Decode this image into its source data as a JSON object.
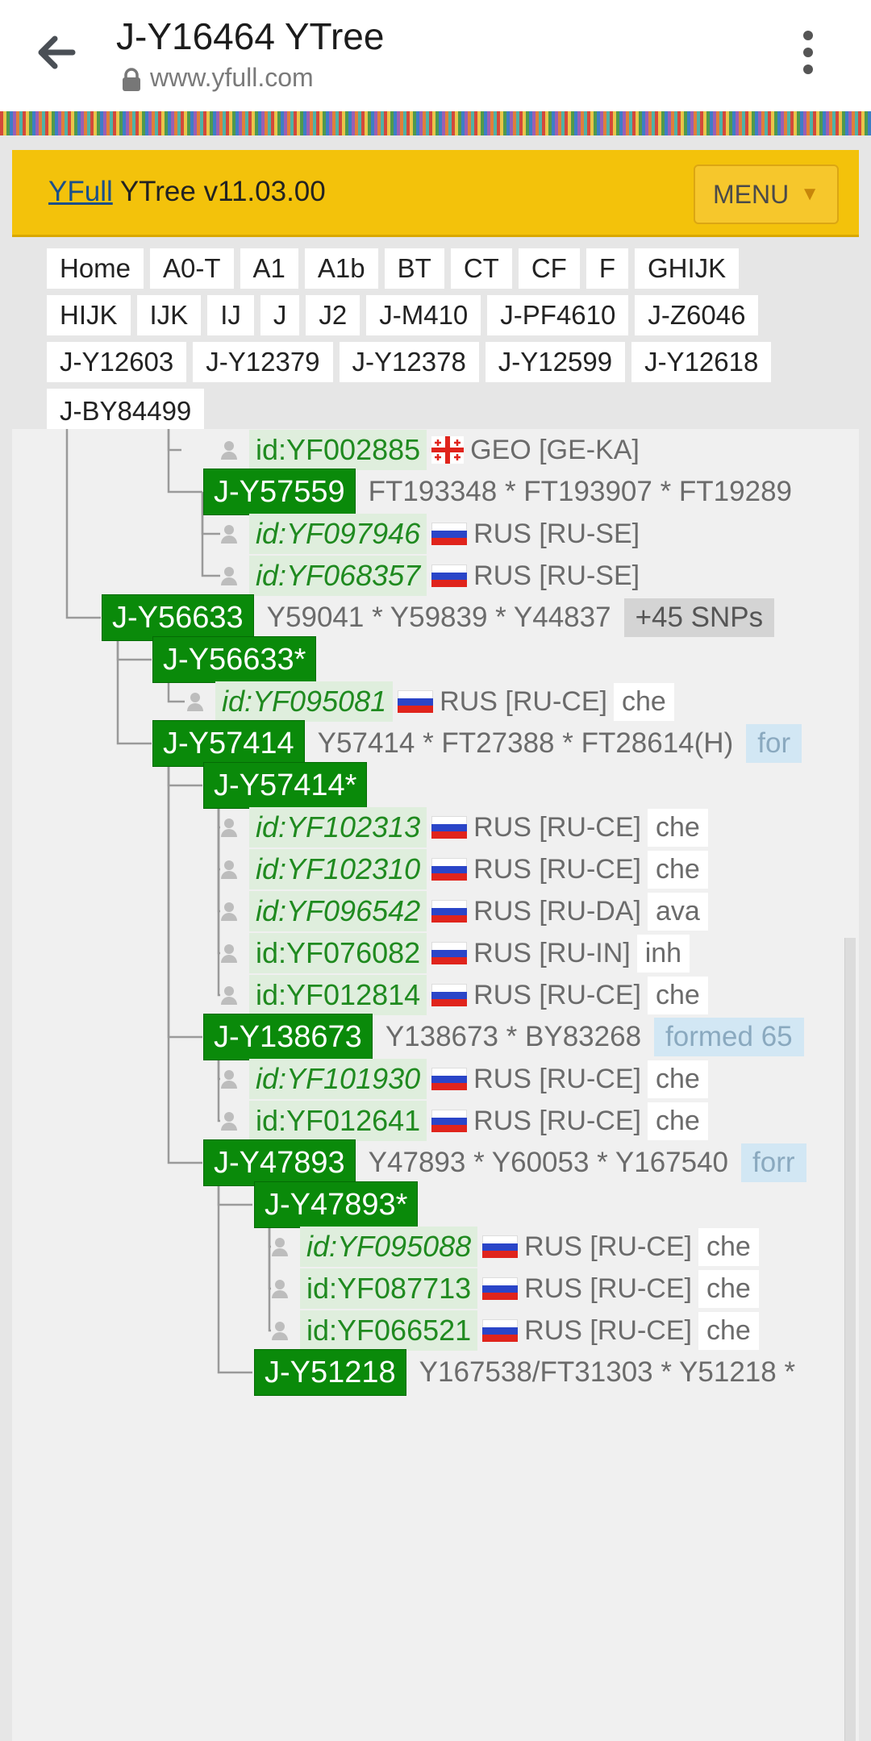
{
  "browser": {
    "title": "J-Y16464 YTree",
    "url": "www.yfull.com",
    "icons": {
      "back": "arrow-left-icon",
      "lock": "lock-icon",
      "more": "more-vert-icon"
    }
  },
  "site_header": {
    "brand_link": "YFull",
    "brand_rest": " YTree v11.03.00",
    "menu_label": "MENU",
    "menu_caret": "▼",
    "colors": {
      "header_bg": "#f3c20b",
      "node_green": "#0a8a0a"
    }
  },
  "breadcrumbs": [
    [
      "Home",
      "A0-T",
      "A1",
      "A1b",
      "BT",
      "CT",
      "CF",
      "F",
      "GHIJK"
    ],
    [
      "HIJK",
      "IJK",
      "IJ",
      "J",
      "J2",
      "J-M410",
      "J-PF4610",
      "J-Z6046"
    ],
    [
      "J-Y12603",
      "J-Y12379",
      "J-Y12378",
      "J-Y12599",
      "J-Y12618"
    ],
    [
      "J-BY84499"
    ]
  ],
  "tree": {
    "rows": [
      {
        "type": "kit",
        "id": "id:YF002885",
        "italic": false,
        "flag": "GE",
        "country": "GEO [GE-KA]",
        "lang": ""
      },
      {
        "type": "node",
        "name": "J-Y57559",
        "snps": "FT193348 * FT193907 * FT19289",
        "badge": "",
        "formed": ""
      },
      {
        "type": "kit",
        "id": "id:YF097946",
        "italic": true,
        "flag": "RU",
        "country": "RUS [RU-SE]",
        "lang": ""
      },
      {
        "type": "kit",
        "id": "id:YF068357",
        "italic": true,
        "flag": "RU",
        "country": "RUS [RU-SE]",
        "lang": ""
      },
      {
        "type": "node",
        "name": "J-Y56633",
        "snps": "Y59041 * Y59839 * Y44837",
        "badge": "+45 SNPs",
        "formed": ""
      },
      {
        "type": "node",
        "name": "J-Y56633*",
        "snps": "",
        "badge": "",
        "formed": ""
      },
      {
        "type": "kit",
        "id": "id:YF095081",
        "italic": true,
        "flag": "RU",
        "country": "RUS [RU-CE]",
        "lang": "che"
      },
      {
        "type": "node",
        "name": "J-Y57414",
        "snps": "Y57414 * FT27388 * FT28614(H)",
        "badge": "",
        "formed": "for"
      },
      {
        "type": "node",
        "name": "J-Y57414*",
        "snps": "",
        "badge": "",
        "formed": ""
      },
      {
        "type": "kit",
        "id": "id:YF102313",
        "italic": true,
        "flag": "RU",
        "country": "RUS [RU-CE]",
        "lang": "che"
      },
      {
        "type": "kit",
        "id": "id:YF102310",
        "italic": true,
        "flag": "RU",
        "country": "RUS [RU-CE]",
        "lang": "che"
      },
      {
        "type": "kit",
        "id": "id:YF096542",
        "italic": true,
        "flag": "RU",
        "country": "RUS [RU-DA]",
        "lang": "ava"
      },
      {
        "type": "kit",
        "id": "id:YF076082",
        "italic": false,
        "flag": "RU",
        "country": "RUS [RU-IN]",
        "lang": "inh"
      },
      {
        "type": "kit",
        "id": "id:YF012814",
        "italic": false,
        "flag": "RU",
        "country": "RUS [RU-CE]",
        "lang": "che"
      },
      {
        "type": "node",
        "name": "J-Y138673",
        "snps": "Y138673 * BY83268",
        "badge": "",
        "formed": "formed 65"
      },
      {
        "type": "kit",
        "id": "id:YF101930",
        "italic": true,
        "flag": "RU",
        "country": "RUS [RU-CE]",
        "lang": "che"
      },
      {
        "type": "kit",
        "id": "id:YF012641",
        "italic": false,
        "flag": "RU",
        "country": "RUS [RU-CE]",
        "lang": "che"
      },
      {
        "type": "node",
        "name": "J-Y47893",
        "snps": "Y47893 * Y60053 * Y167540",
        "badge": "",
        "formed": "forr"
      },
      {
        "type": "node",
        "name": "J-Y47893*",
        "snps": "",
        "badge": "",
        "formed": ""
      },
      {
        "type": "kit",
        "id": "id:YF095088",
        "italic": true,
        "flag": "RU",
        "country": "RUS [RU-CE]",
        "lang": "che"
      },
      {
        "type": "kit",
        "id": "id:YF087713",
        "italic": false,
        "flag": "RU",
        "country": "RUS [RU-CE]",
        "lang": "che"
      },
      {
        "type": "kit",
        "id": "id:YF066521",
        "italic": false,
        "flag": "RU",
        "country": "RUS [RU-CE]",
        "lang": "che"
      },
      {
        "type": "node",
        "name": "J-Y51218",
        "snps": "Y167538/FT31303 * Y51218 *",
        "badge": "",
        "formed": ""
      }
    ]
  }
}
